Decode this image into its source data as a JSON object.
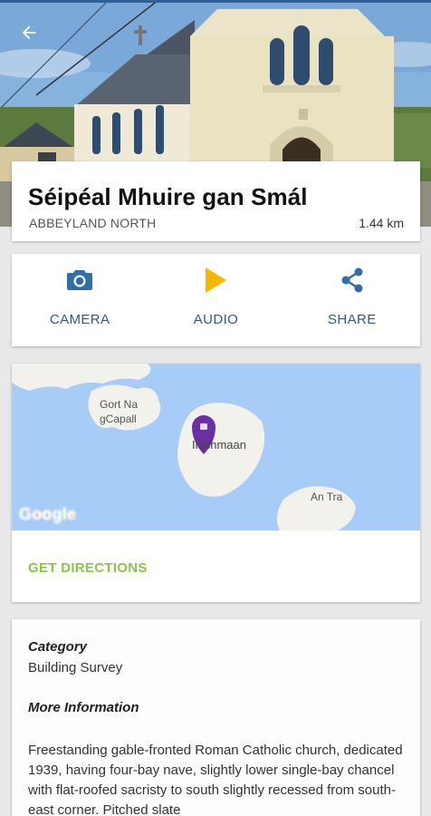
{
  "header": {
    "back_icon": "arrow-left-icon"
  },
  "place": {
    "title": "Séipéal Mhuire gan Smál",
    "area": "ABBEYLAND NORTH",
    "distance": "1.44 km"
  },
  "actions": [
    {
      "label": "CAMERA",
      "icon": "camera-icon",
      "color": "#2f6ea6"
    },
    {
      "label": "AUDIO",
      "icon": "play-icon",
      "color": "#f5b800"
    },
    {
      "label": "SHARE",
      "icon": "share-icon",
      "color": "#2f6ea6"
    }
  ],
  "map": {
    "labels": {
      "gort_line1": "Gort Na",
      "gort_line2": "gCapall",
      "inishmaan": "Inishmaan",
      "an_tra": "An Tra"
    },
    "logo": "Google",
    "pin_color": "#6a2fa3",
    "directions_label": "GET DIRECTIONS"
  },
  "info": {
    "category_heading": "Category",
    "category_value": "Building Survey",
    "more_heading": "More Information",
    "description": "Freestanding gable-fronted Roman Catholic church, dedicated 1939, having four-bay nave, slightly lower single-bay chancel with flat-roofed sacristy to south slightly recessed from south-east corner. Pitched slate"
  },
  "colors": {
    "accent_blue": "#2e5a8a",
    "directions_green": "#8bc34a",
    "map_water": "#a6ccf7",
    "map_land": "#f3f1ec"
  }
}
